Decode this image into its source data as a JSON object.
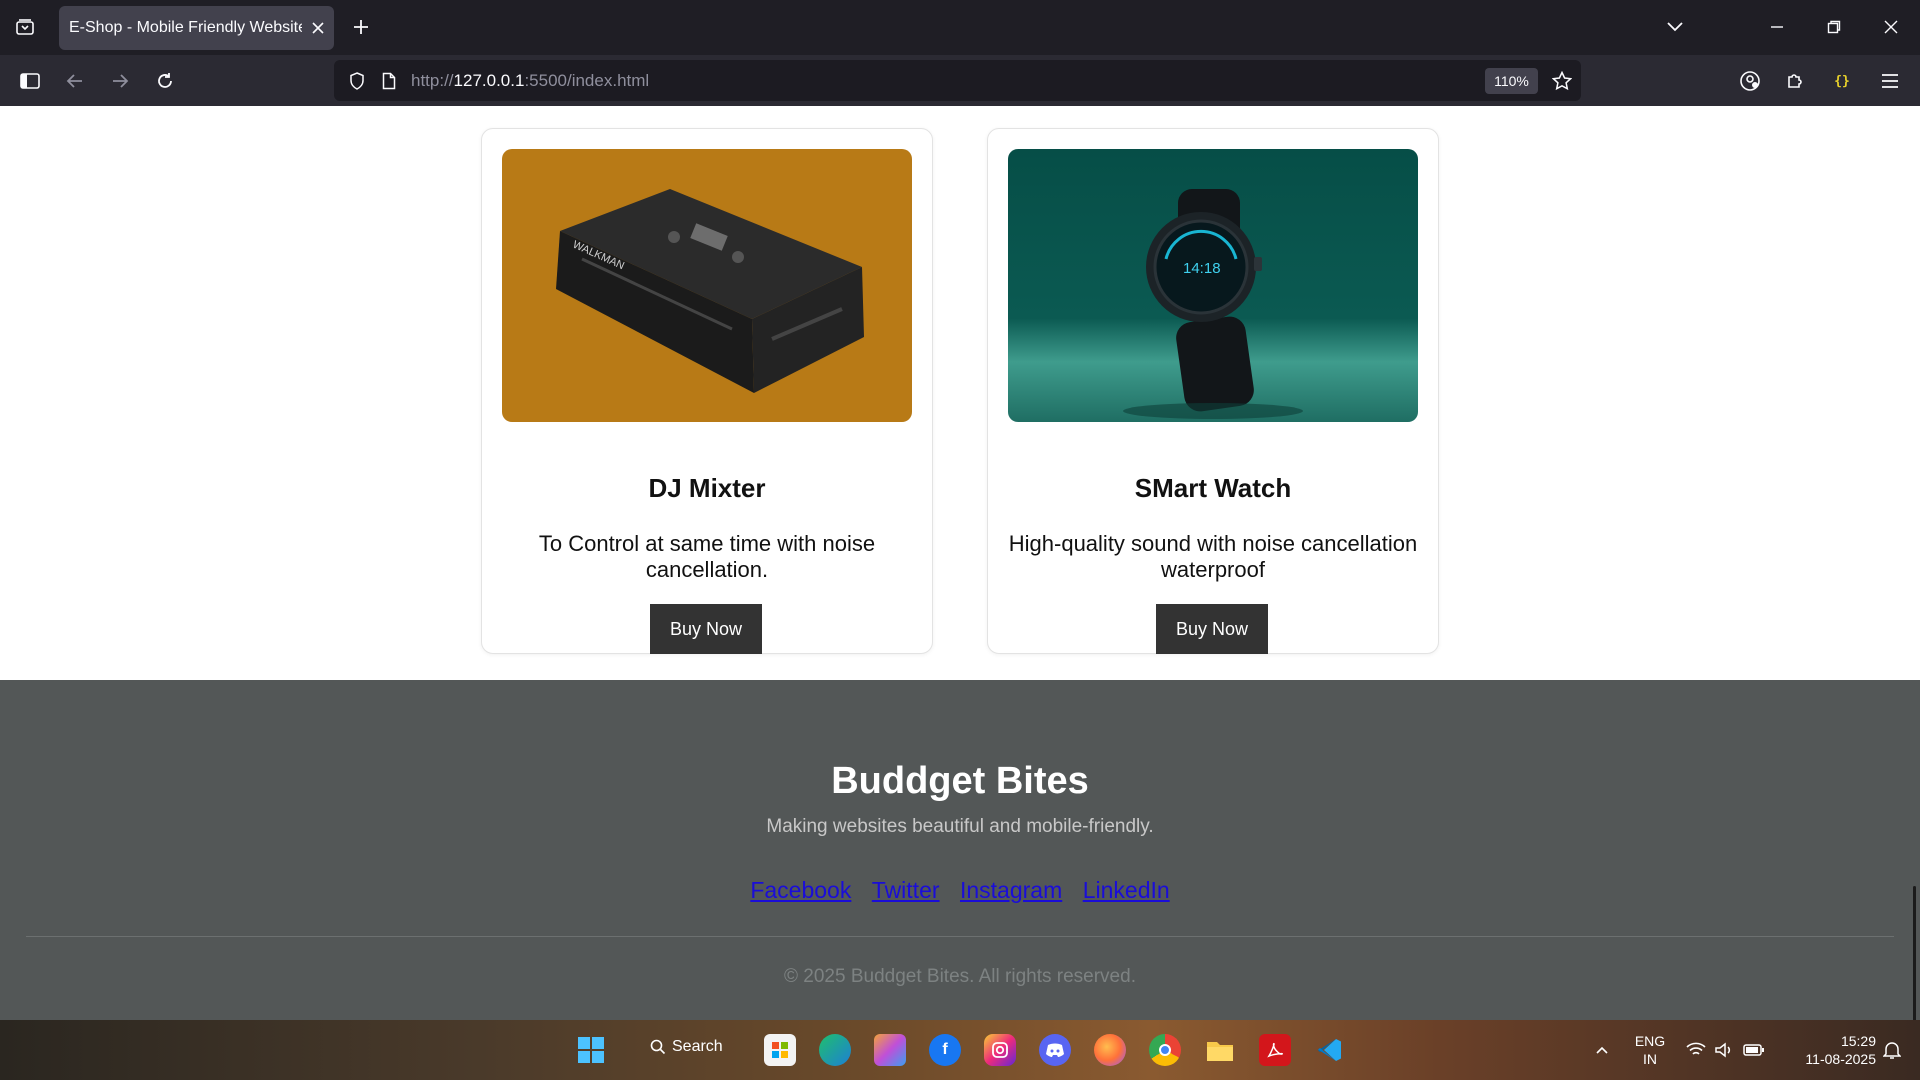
{
  "browser": {
    "tab_title": "E-Shop - Mobile Friendly Website",
    "url_prefix": "http://",
    "url_host": "127.0.0.1",
    "url_rest": ":5500/index.html",
    "zoom": "110%",
    "icons": [
      "tab-list-icon",
      "new-tab-icon",
      "list-all-tabs-icon",
      "minimize-icon",
      "restore-icon",
      "close-window-icon",
      "sidebar-icon",
      "back-icon",
      "forward-icon",
      "reload-icon",
      "shield-icon",
      "page-icon",
      "star-icon",
      "account-icon",
      "extensions-icon",
      "json-extension-icon",
      "menu-icon"
    ]
  },
  "products": [
    {
      "title": "DJ Mixter",
      "description": "To Control at same time with noise cancellation.",
      "button": "Buy Now",
      "image_bg": "#b87a16"
    },
    {
      "title": "SMart Watch",
      "description": "High-quality sound with noise cancellation waterproof",
      "button": "Buy Now",
      "image_bg": "#0b5a52"
    }
  ],
  "footer": {
    "title": "Buddget Bites",
    "tagline": "Making websites beautiful and mobile-friendly.",
    "links": [
      "Facebook",
      "Twitter",
      "Instagram",
      "LinkedIn"
    ],
    "copyright": "© 2025 Buddget Bites. All rights reserved."
  },
  "taskbar": {
    "search_label": "Search",
    "language_line1": "ENG",
    "language_line2": "IN",
    "time": "15:29",
    "date": "11-08-2025"
  },
  "colors": {
    "tab_bar": "#1f1e25",
    "nav_bar": "#2b2a33",
    "footer_bg": "#535757",
    "link": "#1a0dd8",
    "button": "#333333"
  }
}
